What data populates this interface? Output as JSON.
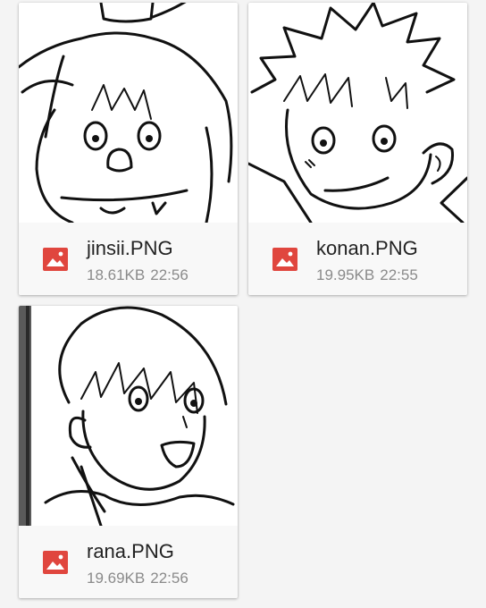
{
  "files": [
    {
      "name": "jinsii.PNG",
      "size": "18.61KB",
      "time": "22:56",
      "icon": "image-file-icon",
      "icon_color": "#e0463e"
    },
    {
      "name": "konan.PNG",
      "size": "19.95KB",
      "time": "22:55",
      "icon": "image-file-icon",
      "icon_color": "#e0463e"
    },
    {
      "name": "rana.PNG",
      "size": "19.69KB",
      "time": "22:56",
      "icon": "image-file-icon",
      "icon_color": "#e0463e"
    }
  ]
}
